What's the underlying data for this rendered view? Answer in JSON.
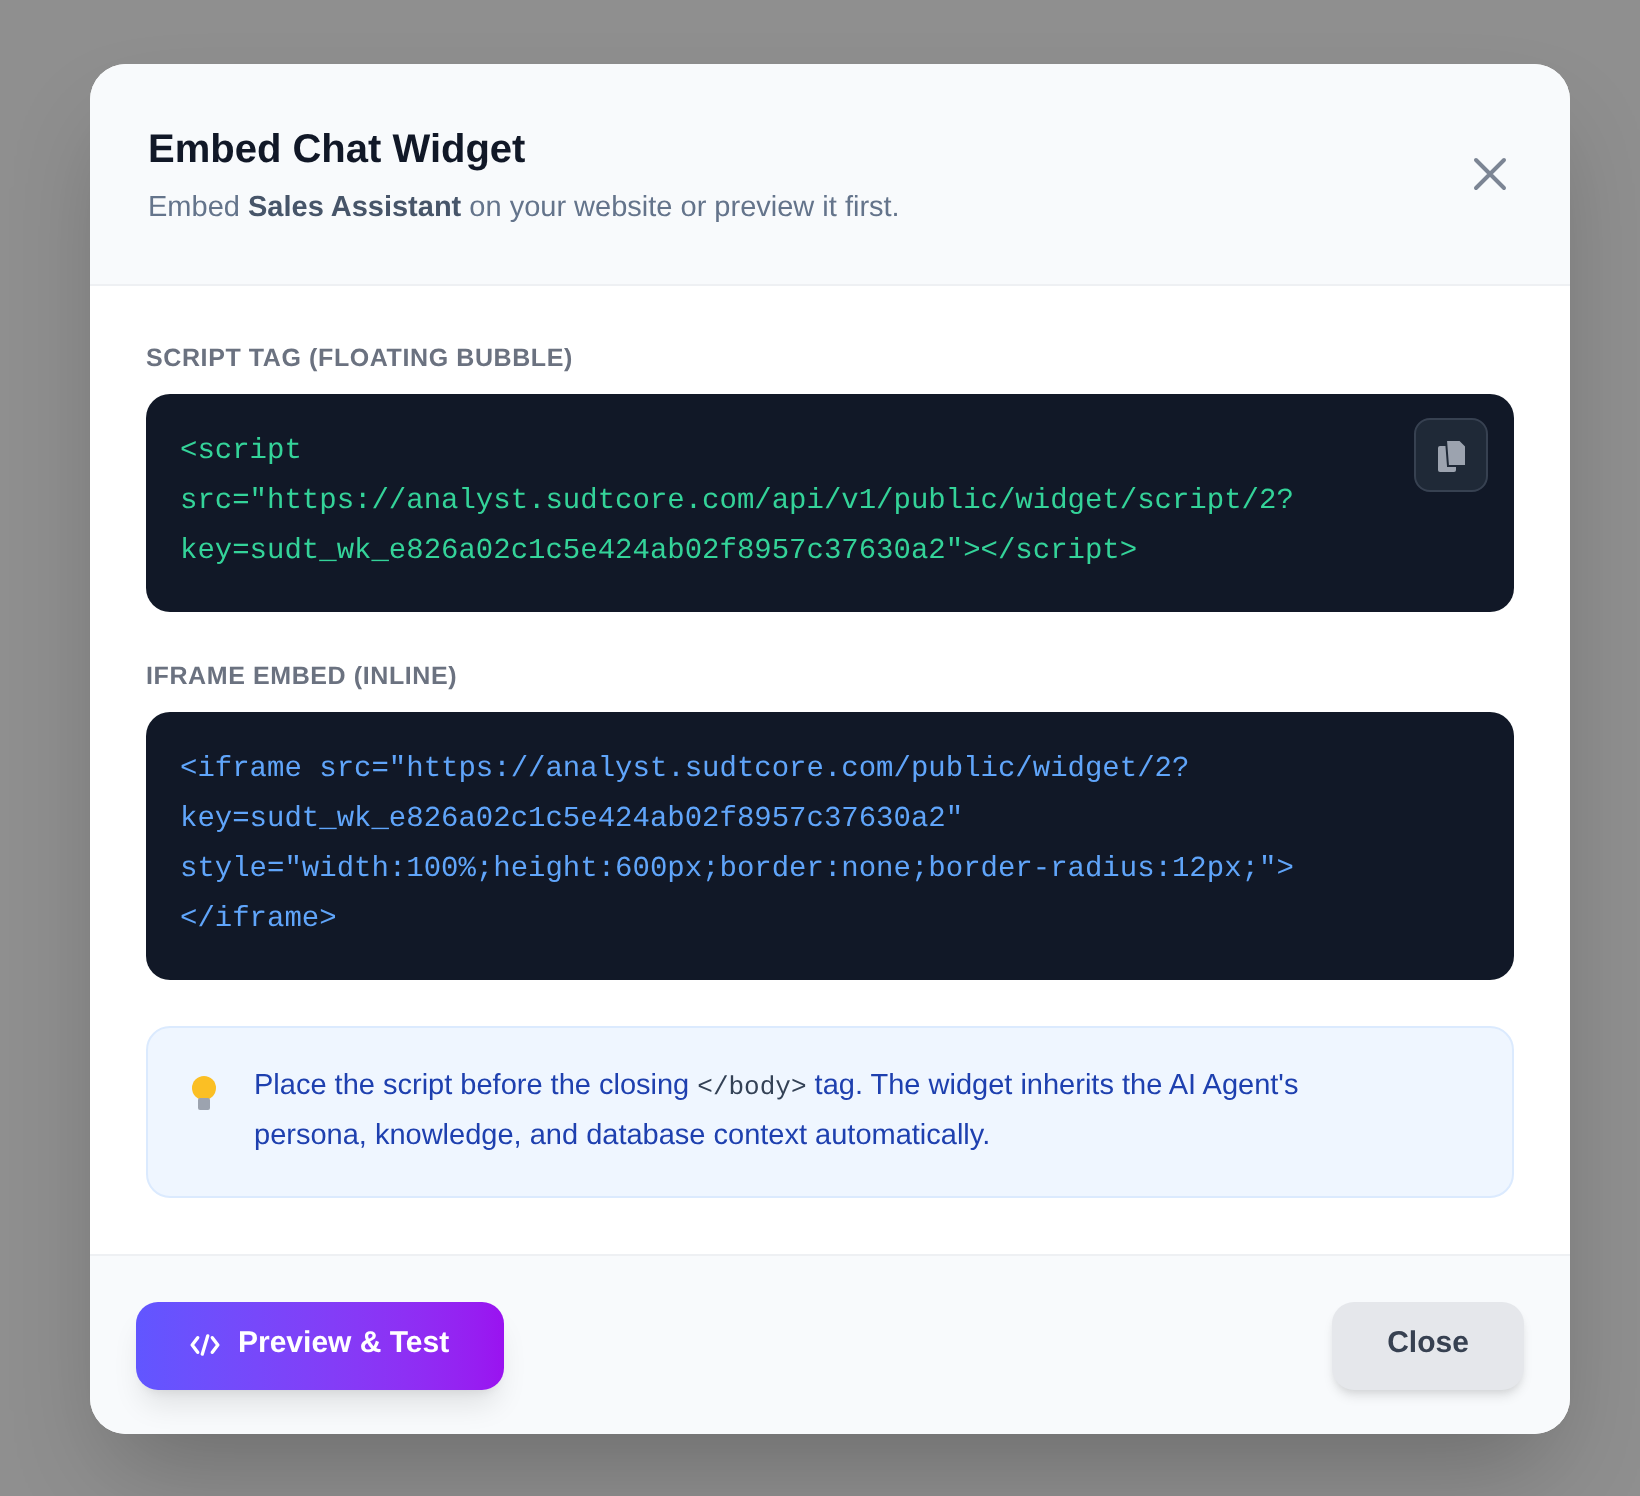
{
  "dialog": {
    "title": "Embed Chat Widget",
    "subtitle": "Embed **Sales Assistant** on your website or preview it first."
  },
  "snippets": [
    {
      "label": "SCRIPT TAG (FLOATING BUBBLE)",
      "kind": "script",
      "copy_button": true,
      "lines": [
        "<script",
        "src=\"https://analyst.sudtcore.com/api/v1/public/widget/script/2?",
        "key=sudt_wk_e826a02c1c5e424ab02f8957c37630a2\"></script>"
      ]
    },
    {
      "label": "IFRAME EMBED (INLINE)",
      "kind": "iframe",
      "copy_button": false,
      "lines": [
        "<iframe src=\"https://analyst.sudtcore.com/public/widget/2?",
        "key=sudt_wk_e826a02c1c5e424ab02f8957c37630a2\"",
        "style=\"width:100%;height:600px;border:none;border-radius:12px;\">",
        "</iframe>"
      ]
    }
  ],
  "tip": {
    "parts": [
      {
        "kind": "text",
        "text": "Place the script before the closing "
      },
      {
        "kind": "code",
        "text": "</body>"
      },
      {
        "kind": "text",
        "text": " tag. The widget inherits the AI Agent's persona, knowledge, and database context automatically."
      }
    ]
  },
  "footer": {
    "primary_button": "Preview & Test",
    "secondary_button": "Close"
  }
}
